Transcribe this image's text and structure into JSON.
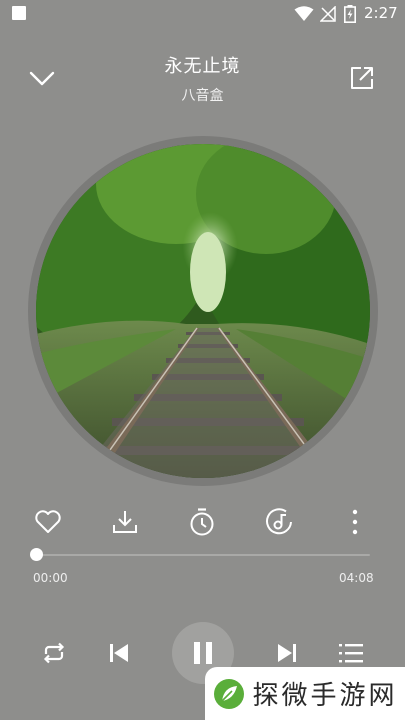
{
  "status_bar": {
    "time": "2:27",
    "icons": [
      "notification-square-icon",
      "wifi-icon",
      "no-sim-icon",
      "battery-charging-icon"
    ]
  },
  "header": {
    "title": "永无止境",
    "artist": "八音盒",
    "left_icon": "chevron-down-icon",
    "right_icon": "share-external-icon"
  },
  "album": {
    "art_description_icon": "railway-forest-art"
  },
  "actions": [
    {
      "name": "like",
      "icon": "heart-icon"
    },
    {
      "name": "download",
      "icon": "download-icon"
    },
    {
      "name": "timer",
      "icon": "timer-icon"
    },
    {
      "name": "sound-effect",
      "icon": "disc-note-icon"
    },
    {
      "name": "more",
      "icon": "more-vertical-icon"
    }
  ],
  "progress": {
    "current": "00:00",
    "total": "04:08",
    "fraction": 0.0
  },
  "controls": {
    "repeat_icon": "repeat-icon",
    "prev_icon": "skip-previous-icon",
    "play_state_icon": "pause-icon",
    "next_icon": "skip-next-icon",
    "playlist_icon": "playlist-icon"
  },
  "watermark": {
    "text": "探微手游网"
  },
  "colors": {
    "background": "#8e8e8c",
    "ring": "#7b7b79",
    "play_button": "#a1a19f",
    "watermark_green": "#5aae3a"
  }
}
